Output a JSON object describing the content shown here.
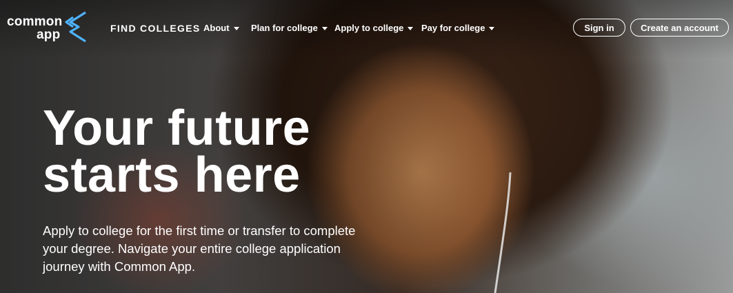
{
  "logo": {
    "line1": "common",
    "line2": "app",
    "mark_icon": "common-app-chevron-logo",
    "mark_color": "#4fb3ff"
  },
  "nav": {
    "find_colleges": "FIND COLLEGES",
    "menus": [
      {
        "label": "About",
        "icon": "caret-down-icon"
      },
      {
        "label": "Plan for college",
        "icon": "caret-down-icon"
      },
      {
        "label": "Apply to college",
        "icon": "caret-down-icon"
      },
      {
        "label": "Pay for college",
        "icon": "caret-down-icon"
      }
    ],
    "sign_in": "Sign in",
    "create_account": "Create an account"
  },
  "hero": {
    "title_line1": "Your future",
    "title_line2": "starts here",
    "subtitle": "Apply to college for the first time or transfer to complete your degree. Navigate your entire college application journey with Common App."
  }
}
